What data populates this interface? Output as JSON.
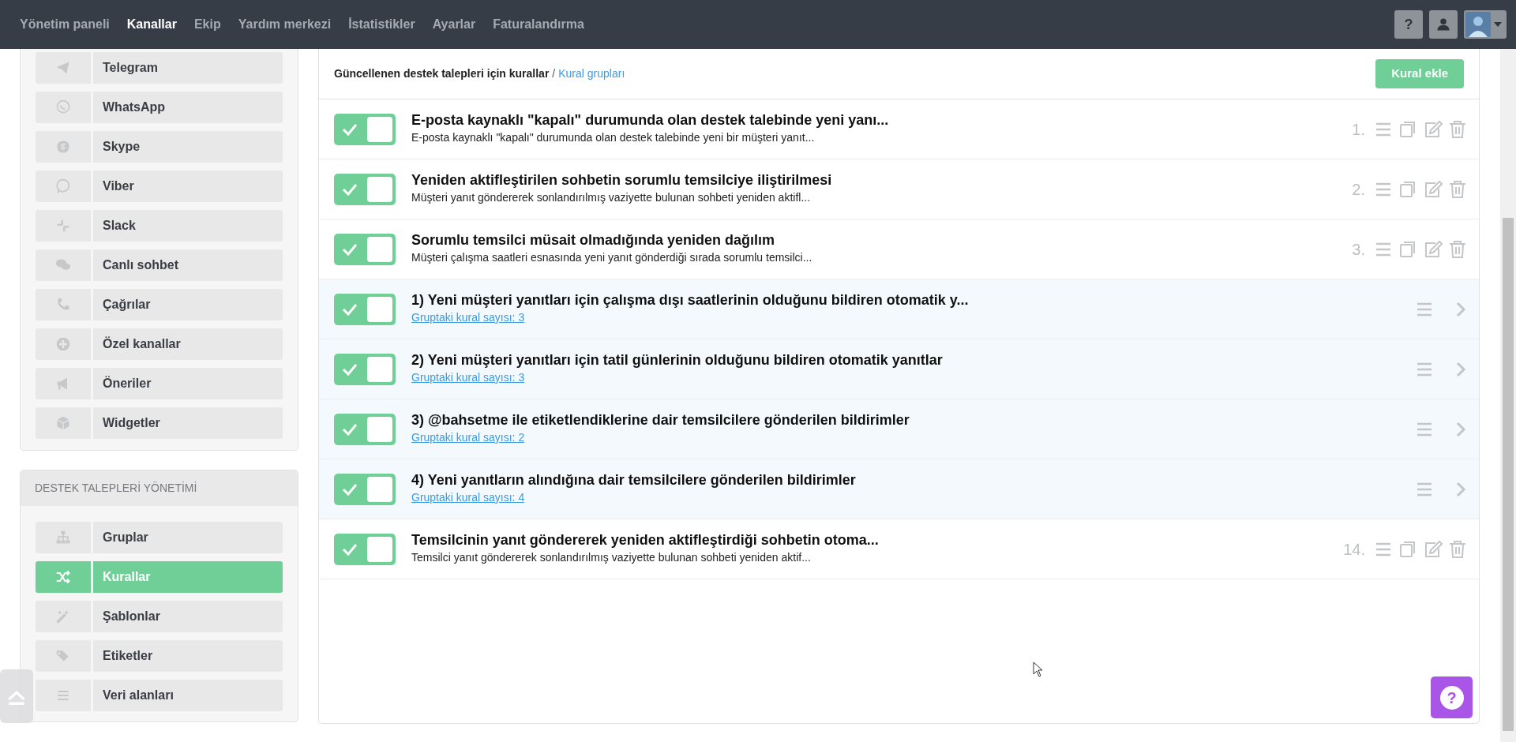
{
  "navbar": {
    "items": [
      {
        "label": "Yönetim paneli",
        "selected": false
      },
      {
        "label": "Kanallar",
        "selected": true
      },
      {
        "label": "Ekip",
        "selected": false
      },
      {
        "label": "Yardım merkezi",
        "selected": false
      },
      {
        "label": "İstatistikler",
        "selected": false
      },
      {
        "label": "Ayarlar",
        "selected": false
      },
      {
        "label": "Faturalandırma",
        "selected": false
      }
    ],
    "help_button": "?"
  },
  "sidebar": {
    "channels": [
      {
        "label": "Telegram",
        "selected": false
      },
      {
        "label": "WhatsApp",
        "selected": false
      },
      {
        "label": "Skype",
        "selected": false
      },
      {
        "label": "Viber",
        "selected": false
      },
      {
        "label": "Slack",
        "selected": false
      },
      {
        "label": "Canlı sohbet",
        "selected": false
      },
      {
        "label": "Çağrılar",
        "selected": false
      },
      {
        "label": "Özel kanallar",
        "selected": false
      },
      {
        "label": "Öneriler",
        "selected": false
      },
      {
        "label": "Widgetler",
        "selected": false
      }
    ],
    "management": {
      "title": "DESTEK TALEPLERİ YÖNETİMİ",
      "items": [
        {
          "label": "Gruplar",
          "selected": false
        },
        {
          "label": "Kurallar",
          "selected": true
        },
        {
          "label": "Şablonlar",
          "selected": false
        },
        {
          "label": "Etiketler",
          "selected": false
        },
        {
          "label": "Veri alanları",
          "selected": false
        }
      ]
    }
  },
  "main": {
    "breadcrumb": {
      "current": "Güncellenen destek talepleri için kurallar",
      "separator": "/",
      "link": "Kural grupları"
    },
    "add_button": "Kural ekle",
    "rows": [
      {
        "kind": "rule",
        "on": true,
        "title": "E-posta kaynaklı \"kapalı\" durumunda olan destek talebinde yeni yanı...",
        "description": "E-posta kaynaklı \"kapalı\" durumunda olan destek talebinde yeni bir müşteri yanıt...",
        "number": "1."
      },
      {
        "kind": "rule",
        "on": true,
        "title": "Yeniden aktifleştirilen sohbetin sorumlu temsilciye iliştirilmesi",
        "description": "Müşteri yanıt göndererek sonlandırılmış vaziyette bulunan sohbeti yeniden aktifl...",
        "number": "2."
      },
      {
        "kind": "rule",
        "on": true,
        "title": "Sorumlu temsilci müsait olmadığında yeniden dağılım",
        "description": "Müşteri çalışma saatleri esnasında yeni yanıt gönderdiği sırada sorumlu temsilci...",
        "number": "3."
      },
      {
        "kind": "group",
        "on": true,
        "title": "1) Yeni müşteri yanıtları için çalışma dışı saatlerinin olduğunu bildiren otomatik y...",
        "count": "Gruptaki kural sayısı: 3"
      },
      {
        "kind": "group",
        "on": true,
        "title": "2) Yeni müşteri yanıtları için tatil günlerinin olduğunu bildiren otomatik yanıtlar",
        "count": "Gruptaki kural sayısı: 3"
      },
      {
        "kind": "group",
        "on": true,
        "title": "3) @bahsetme ile etiketlendiklerine dair temsilcilere gönderilen bildirimler",
        "count": "Gruptaki kural sayısı: 2"
      },
      {
        "kind": "group",
        "on": true,
        "title": "4) Yeni yanıtların alındığına dair temsilcilere gönderilen bildirimler",
        "count": "Gruptaki kural sayısı: 4"
      },
      {
        "kind": "rule",
        "on": true,
        "title": "Temsilcinin yanıt göndererek yeniden aktifleştirdiği sohbetin otoma...",
        "description": "Temsilci yanıt göndererek sonlandırılmış vaziyette bulunan sohbeti yeniden aktif...",
        "number": "14."
      }
    ],
    "help_fab": "?"
  }
}
